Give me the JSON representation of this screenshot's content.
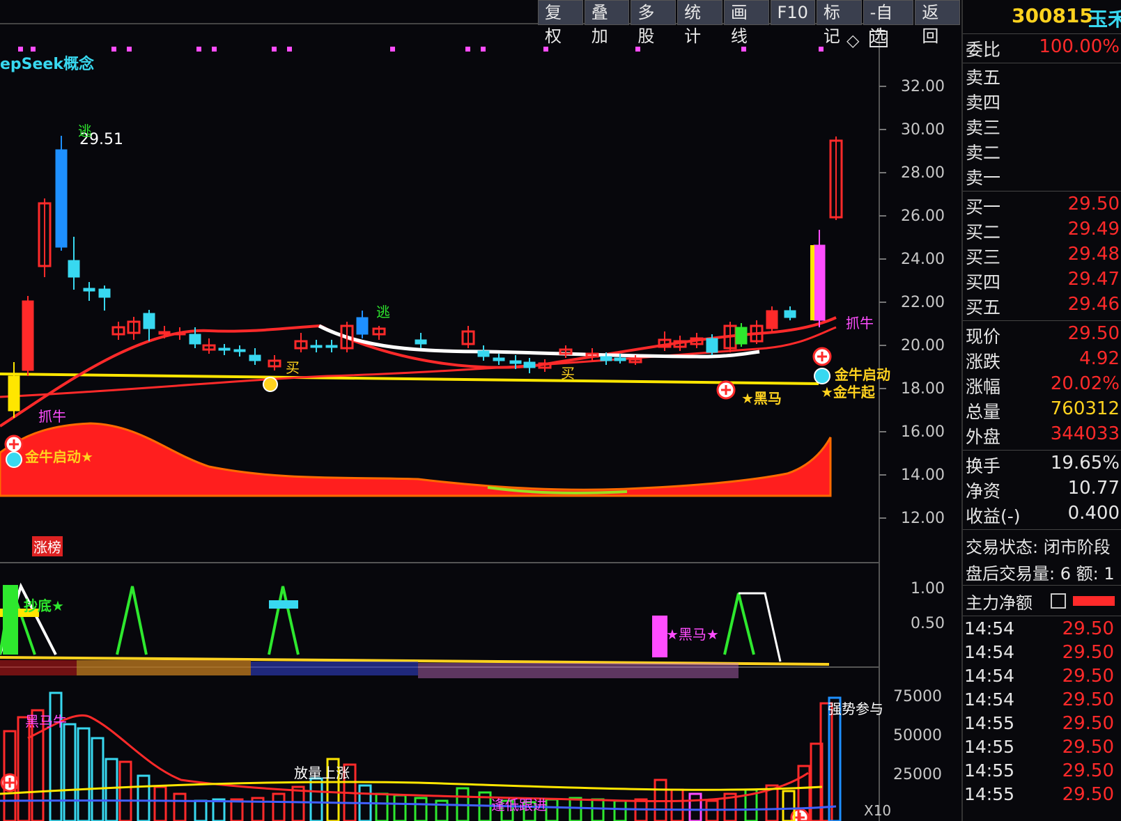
{
  "toolbar": {
    "buttons": [
      "复权",
      "叠加",
      "多股",
      "统计",
      "画线",
      "F10",
      "标记",
      "-自选",
      "返回"
    ]
  },
  "concept_label": "epSeek概念",
  "price_axis": [
    "32.00",
    "30.00",
    "28.00",
    "26.00",
    "24.00",
    "22.00",
    "20.00",
    "18.00",
    "16.00",
    "14.00",
    "12.00"
  ],
  "signal_axis": [
    "1.00",
    "0.50"
  ],
  "volume_axis": [
    "75000",
    "50000",
    "25000",
    "X10"
  ],
  "annotations": {
    "high_price": "29.51",
    "escape_1": "逃",
    "escape_2": "逃",
    "grab_bull_left": "抓牛",
    "grab_bull_right": "抓牛",
    "golden_bull_start": "金牛启动★",
    "buy_1": "买",
    "buy_2": "买",
    "dark_horse": "★黑马",
    "golden_bull_right_1": "金牛启动",
    "golden_bull_right_2": "★金牛起",
    "limit_list": "涨榜",
    "bottom_fish": "抄底★",
    "dark_horse_star": "★黑马★",
    "volume_breakout": "放量上涨",
    "low_follow": "逢低跟进",
    "strong_uptrend": "强势参与",
    "dark_horse_bull": "黑马牛"
  },
  "stock": {
    "code": "300815",
    "name": "玉禾"
  },
  "order_book": {
    "ratio_label": "委比",
    "ratio_value": "100.00%",
    "sell": [
      {
        "label": "卖五",
        "price": ""
      },
      {
        "label": "卖四",
        "price": ""
      },
      {
        "label": "卖三",
        "price": ""
      },
      {
        "label": "卖二",
        "price": ""
      },
      {
        "label": "卖一",
        "price": ""
      }
    ],
    "buy": [
      {
        "label": "买一",
        "price": "29.50"
      },
      {
        "label": "买二",
        "price": "29.49"
      },
      {
        "label": "买三",
        "price": "29.48"
      },
      {
        "label": "买四",
        "price": "29.47"
      },
      {
        "label": "买五",
        "price": "29.46"
      }
    ]
  },
  "quote": [
    {
      "label": "现价",
      "value": "29.50",
      "color": "#ff2a2a"
    },
    {
      "label": "涨跌",
      "value": "4.92",
      "color": "#ff2a2a"
    },
    {
      "label": "涨幅",
      "value": "20.02%",
      "color": "#ff2a2a"
    },
    {
      "label": "总量",
      "value": "760312",
      "color": "#ffd21f"
    },
    {
      "label": "外盘",
      "value": "344033",
      "color": "#ff2a2a"
    }
  ],
  "fundamentals": [
    {
      "label": "换手",
      "value": "19.65%"
    },
    {
      "label": "净资",
      "value": "10.77"
    },
    {
      "label": "收益(-)",
      "value": "0.400"
    }
  ],
  "status": {
    "trade_state": "交易状态: 闭市阶段",
    "after_hours": "盘后交易量: 6  额: 1",
    "main_net_label": "主力净额"
  },
  "ticks": [
    {
      "time": "14:54",
      "price": "29.50"
    },
    {
      "time": "14:54",
      "price": "29.50"
    },
    {
      "time": "14:54",
      "price": "29.50"
    },
    {
      "time": "14:54",
      "price": "29.50"
    },
    {
      "time": "14:55",
      "price": "29.50"
    },
    {
      "time": "14:55",
      "price": "29.50"
    },
    {
      "time": "14:55",
      "price": "29.50"
    },
    {
      "time": "14:55",
      "price": "29.50"
    }
  ],
  "colors": {
    "up": "#ff2a2a",
    "down": "#1e90ff",
    "yellow_line": "#ffe600",
    "cyan": "#38d8f0",
    "magenta": "#ff4dff",
    "green": "#2ee82e"
  }
}
